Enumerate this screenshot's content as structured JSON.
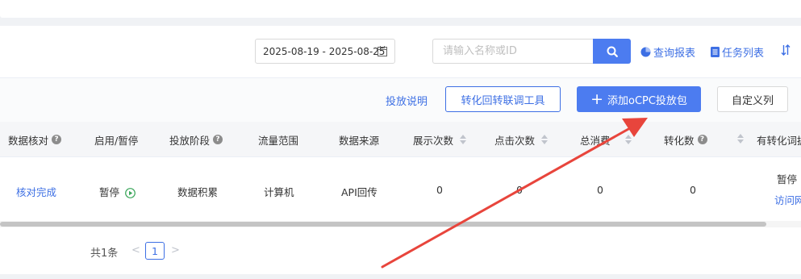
{
  "toolbar": {
    "date_range": "2025-08-19 - 2025-08-25",
    "search_placeholder": "请输入名称或ID",
    "query_report": "查询报表",
    "task_list": "任务列表"
  },
  "actions": {
    "guide_link": "投放说明",
    "conversion_tool": "转化回转联调工具",
    "add_package_plus": "+",
    "add_package": "添加oCPC投放包",
    "custom_columns": "自定义列"
  },
  "table": {
    "headers": {
      "data_check": "数据核对",
      "toggle": "启用/暂停",
      "stage": "投放阶段",
      "traffic": "流量范围",
      "source": "数据来源",
      "impressions": "展示次数",
      "clicks": "点击次数",
      "cost": "总消费",
      "conversions": "转化数",
      "conv_words": "有转化词据"
    },
    "row": {
      "data_check": "核对完成",
      "status": "暂停",
      "stage": "数据积累",
      "traffic": "计算机",
      "source": "API回传",
      "impressions": "0",
      "clicks": "0",
      "cost": "0",
      "conversions": "0",
      "last_status": "暂停",
      "last_link": "访问网"
    }
  },
  "pagination": {
    "total": "共1条",
    "prev": "<",
    "current": "1",
    "next": ">"
  },
  "colors": {
    "primary": "#4c7cf0",
    "link": "#3d6fe4",
    "annotation_arrow": "#e8453c"
  }
}
